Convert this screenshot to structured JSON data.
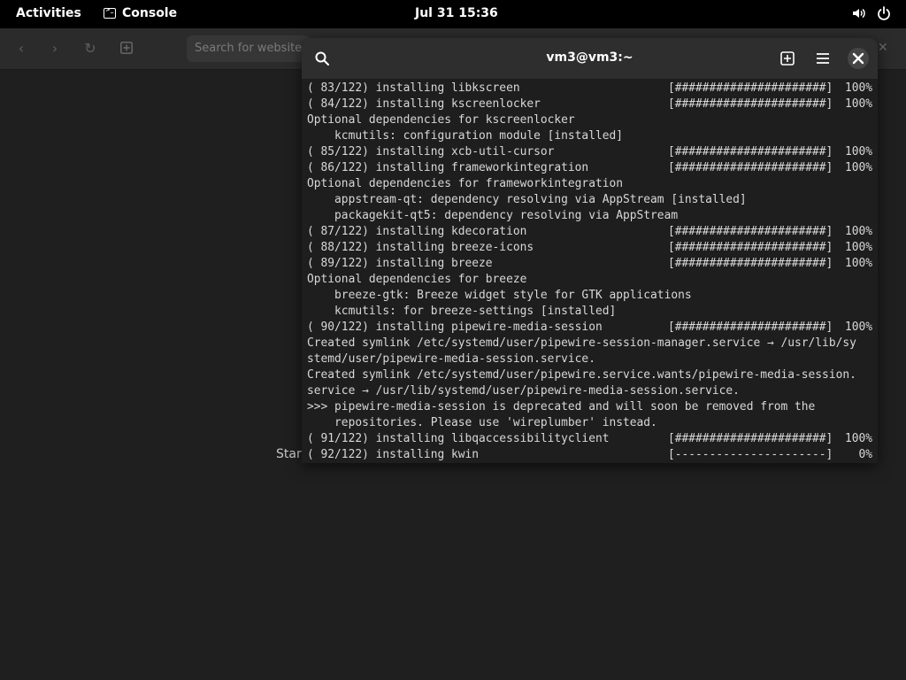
{
  "topbar": {
    "activities": "Activities",
    "app_name": "Console",
    "clock": "Jul 31  15:36",
    "icons": [
      "volume-icon",
      "power-icon"
    ]
  },
  "browser": {
    "url_placeholder": "Search for website",
    "status_fragment": "Starı"
  },
  "terminal": {
    "title": "vm3@vm3:~",
    "lines": [
      {
        "text": "( 83/122) installing libkscreen",
        "bar": "[######################]",
        "pct": "100%"
      },
      {
        "text": "( 84/122) installing kscreenlocker",
        "bar": "[######################]",
        "pct": "100%"
      },
      {
        "text": "Optional dependencies for kscreenlocker"
      },
      {
        "text": "    kcmutils: configuration module [installed]"
      },
      {
        "text": "( 85/122) installing xcb-util-cursor",
        "bar": "[######################]",
        "pct": "100%"
      },
      {
        "text": "( 86/122) installing frameworkintegration",
        "bar": "[######################]",
        "pct": "100%"
      },
      {
        "text": "Optional dependencies for frameworkintegration"
      },
      {
        "text": "    appstream-qt: dependency resolving via AppStream [installed]"
      },
      {
        "text": "    packagekit-qt5: dependency resolving via AppStream"
      },
      {
        "text": "( 87/122) installing kdecoration",
        "bar": "[######################]",
        "pct": "100%"
      },
      {
        "text": "( 88/122) installing breeze-icons",
        "bar": "[######################]",
        "pct": "100%"
      },
      {
        "text": "( 89/122) installing breeze",
        "bar": "[######################]",
        "pct": "100%"
      },
      {
        "text": "Optional dependencies for breeze"
      },
      {
        "text": "    breeze-gtk: Breeze widget style for GTK applications"
      },
      {
        "text": "    kcmutils: for breeze-settings [installed]"
      },
      {
        "text": "( 90/122) installing pipewire-media-session",
        "bar": "[######################]",
        "pct": "100%"
      },
      {
        "text": "Created symlink /etc/systemd/user/pipewire-session-manager.service → /usr/lib/sy"
      },
      {
        "text": "stemd/user/pipewire-media-session.service."
      },
      {
        "text": "Created symlink /etc/systemd/user/pipewire.service.wants/pipewire-media-session."
      },
      {
        "text": "service → /usr/lib/systemd/user/pipewire-media-session.service."
      },
      {
        "text": ">>> pipewire-media-session is deprecated and will soon be removed from the"
      },
      {
        "text": "    repositories. Please use 'wireplumber' instead."
      },
      {
        "text": "( 91/122) installing libqaccessibilityclient",
        "bar": "[######################]",
        "pct": "100%"
      },
      {
        "text": "( 92/122) installing kwin",
        "bar": "[----------------------]",
        "pct": "0%"
      }
    ]
  }
}
